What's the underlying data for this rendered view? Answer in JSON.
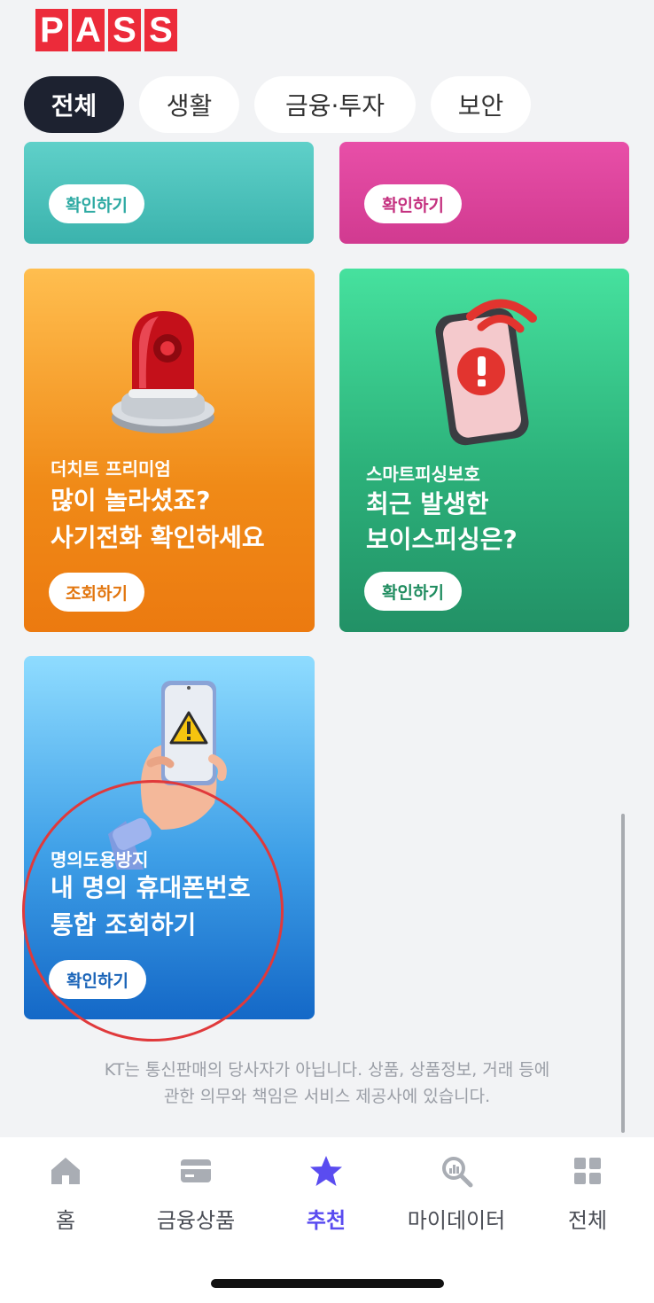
{
  "logo": {
    "letters": [
      "P",
      "A",
      "S",
      "S"
    ],
    "color": "#ec2b3a"
  },
  "tabs": [
    {
      "label": "전체",
      "active": true
    },
    {
      "label": "생활",
      "active": false
    },
    {
      "label": "금융·투자",
      "active": false
    },
    {
      "label": "보안",
      "active": false
    }
  ],
  "cards": {
    "teal": {
      "button": "확인하기"
    },
    "pink": {
      "button": "확인하기"
    },
    "orange": {
      "eyebrow": "더치트 프리미엄",
      "title_line1": "많이 놀라셨죠?",
      "title_line2": "사기전화 확인하세요",
      "button": "조회하기",
      "icon": "siren-icon"
    },
    "green": {
      "eyebrow": "스마트피싱보호",
      "title_line1": "최근 발생한",
      "title_line2": "보이스피싱은?",
      "button": "확인하기",
      "icon": "phone-alert-icon"
    },
    "blue": {
      "eyebrow": "명의도용방지",
      "title_line1": "내 명의 휴대폰번호",
      "title_line2": "통합 조회하기",
      "button": "확인하기",
      "icon": "hand-phone-warning-icon"
    }
  },
  "disclaimer": {
    "line1": "KT는 통신판매의 당사자가 아닙니다. 상품, 상품정보, 거래 등에",
    "line2": "관한 의무와 책임은 서비스 제공사에 있습니다."
  },
  "bottom_nav": [
    {
      "label": "홈",
      "icon": "home-icon",
      "active": false
    },
    {
      "label": "금융상품",
      "icon": "card-icon",
      "active": false
    },
    {
      "label": "추천",
      "icon": "star-icon",
      "active": true
    },
    {
      "label": "마이데이터",
      "icon": "data-search-icon",
      "active": false
    },
    {
      "label": "전체",
      "icon": "grid-icon",
      "active": false
    }
  ],
  "colors": {
    "accent": "#5a4cf0",
    "active_tab_bg": "#1d2230",
    "annotation": "#e0393b"
  }
}
